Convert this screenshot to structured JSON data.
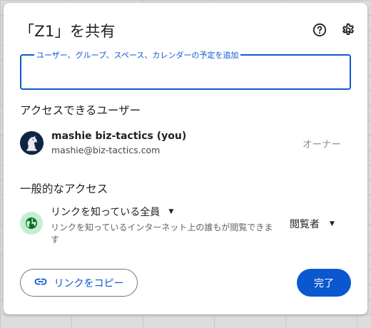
{
  "dialog": {
    "title": "「Z1」を共有",
    "help_icon": "help-circle-icon",
    "settings_icon": "gear-icon"
  },
  "add_people": {
    "label": "ユーザー、グループ、スペース、カレンダーの予定を追加",
    "value": ""
  },
  "people_section": {
    "heading": "アクセスできるユーザー",
    "users": [
      {
        "name": "mashie biz-tactics (you)",
        "email": "mashie@biz-tactics.com",
        "role": "オーナー"
      }
    ]
  },
  "general_access": {
    "heading": "一般的なアクセス",
    "link_setting": "リンクを知っている全員",
    "description": "リンクを知っているインターネット上の誰もが閲覧できます",
    "role": "閲覧者",
    "icon": "globe-icon"
  },
  "footer": {
    "copy_link_label": "リンクをコピー",
    "copy_icon": "link-icon",
    "done_label": "完了"
  },
  "colors": {
    "accent": "#0b57d0",
    "globe_bg": "#c4eed0",
    "globe_fg": "#146c2e"
  }
}
